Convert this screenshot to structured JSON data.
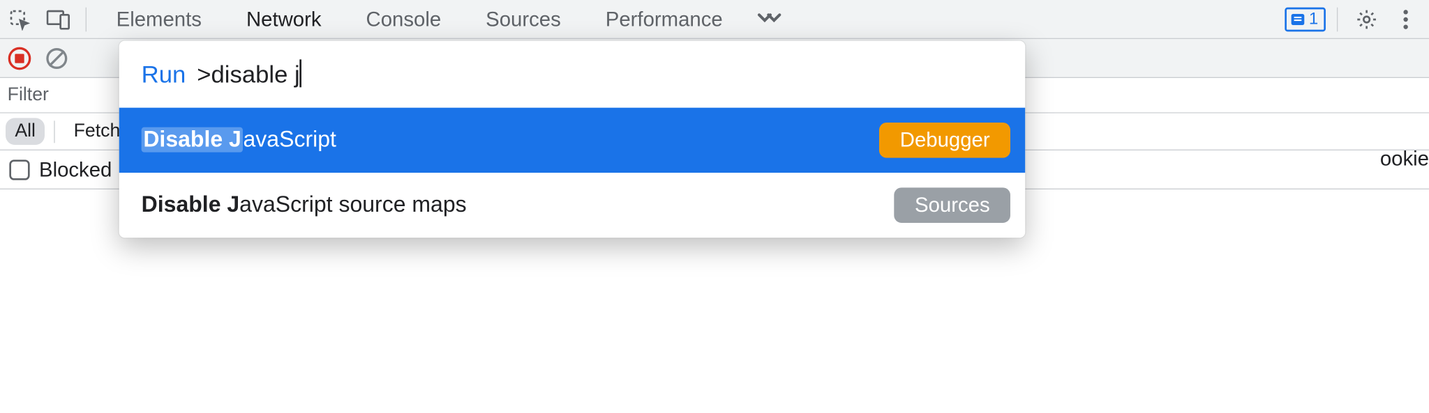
{
  "tabs": {
    "elements": "Elements",
    "network": "Network",
    "console": "Console",
    "sources": "Sources",
    "performance": "Performance",
    "active": "network"
  },
  "issues": {
    "count": "1"
  },
  "filter": {
    "label": "Filter"
  },
  "chips": {
    "all": "All",
    "fetchxhr": "Fetch"
  },
  "blocked": {
    "label": "Blocked"
  },
  "edge": {
    "cookies": "ookie"
  },
  "palette": {
    "run_label": "Run",
    "prompt_prefix": ">",
    "query": "disable j",
    "items": [
      {
        "hl": "Disable J",
        "rest": "avaScript",
        "panel": "Debugger",
        "selected": true
      },
      {
        "match": "Disable J",
        "rest": "avaScript source maps",
        "panel": "Sources",
        "selected": false
      }
    ]
  }
}
